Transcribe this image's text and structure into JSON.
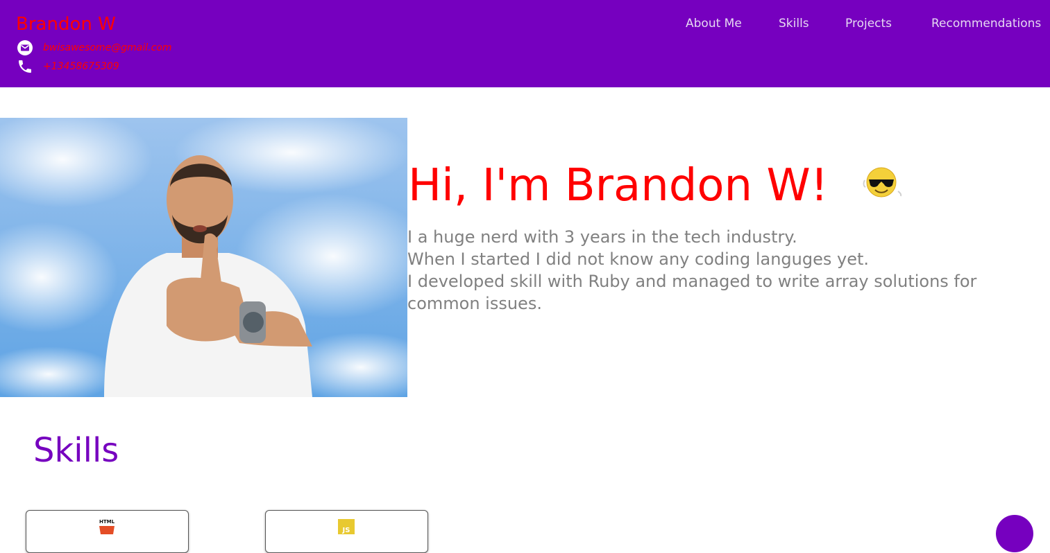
{
  "header": {
    "brand": "Brandon W",
    "email": "bwisawesome@gmail.com",
    "phone": "+13458675309",
    "nav": [
      {
        "label": "About Me"
      },
      {
        "label": "Skills"
      },
      {
        "label": "Projects"
      },
      {
        "label": "Recommendations"
      }
    ]
  },
  "hero": {
    "title": "Hi, I'm Brandon W!",
    "bio": [
      "I a huge nerd with 3 years in the tech industry.",
      "When I started I did not know any coding languges yet.",
      "I developed skill with Ruby and managed to write array solutions for",
      "common issues."
    ],
    "photo_icon": "profile-photo",
    "emoji_icon": "sunglasses-emoji-icon"
  },
  "skills": {
    "title": "Skills",
    "cards": [
      {
        "icon": "html5-icon",
        "logo_text": "HTML"
      },
      {
        "icon": "javascript-icon",
        "logo_text": "JS"
      }
    ]
  },
  "colors": {
    "header_bg": "#7600bf",
    "brand": "#ff0000",
    "nav_text": "#e6d8f2",
    "hero_title": "#ff0000",
    "bio_text": "#808080",
    "skills_title": "#7600bf"
  }
}
